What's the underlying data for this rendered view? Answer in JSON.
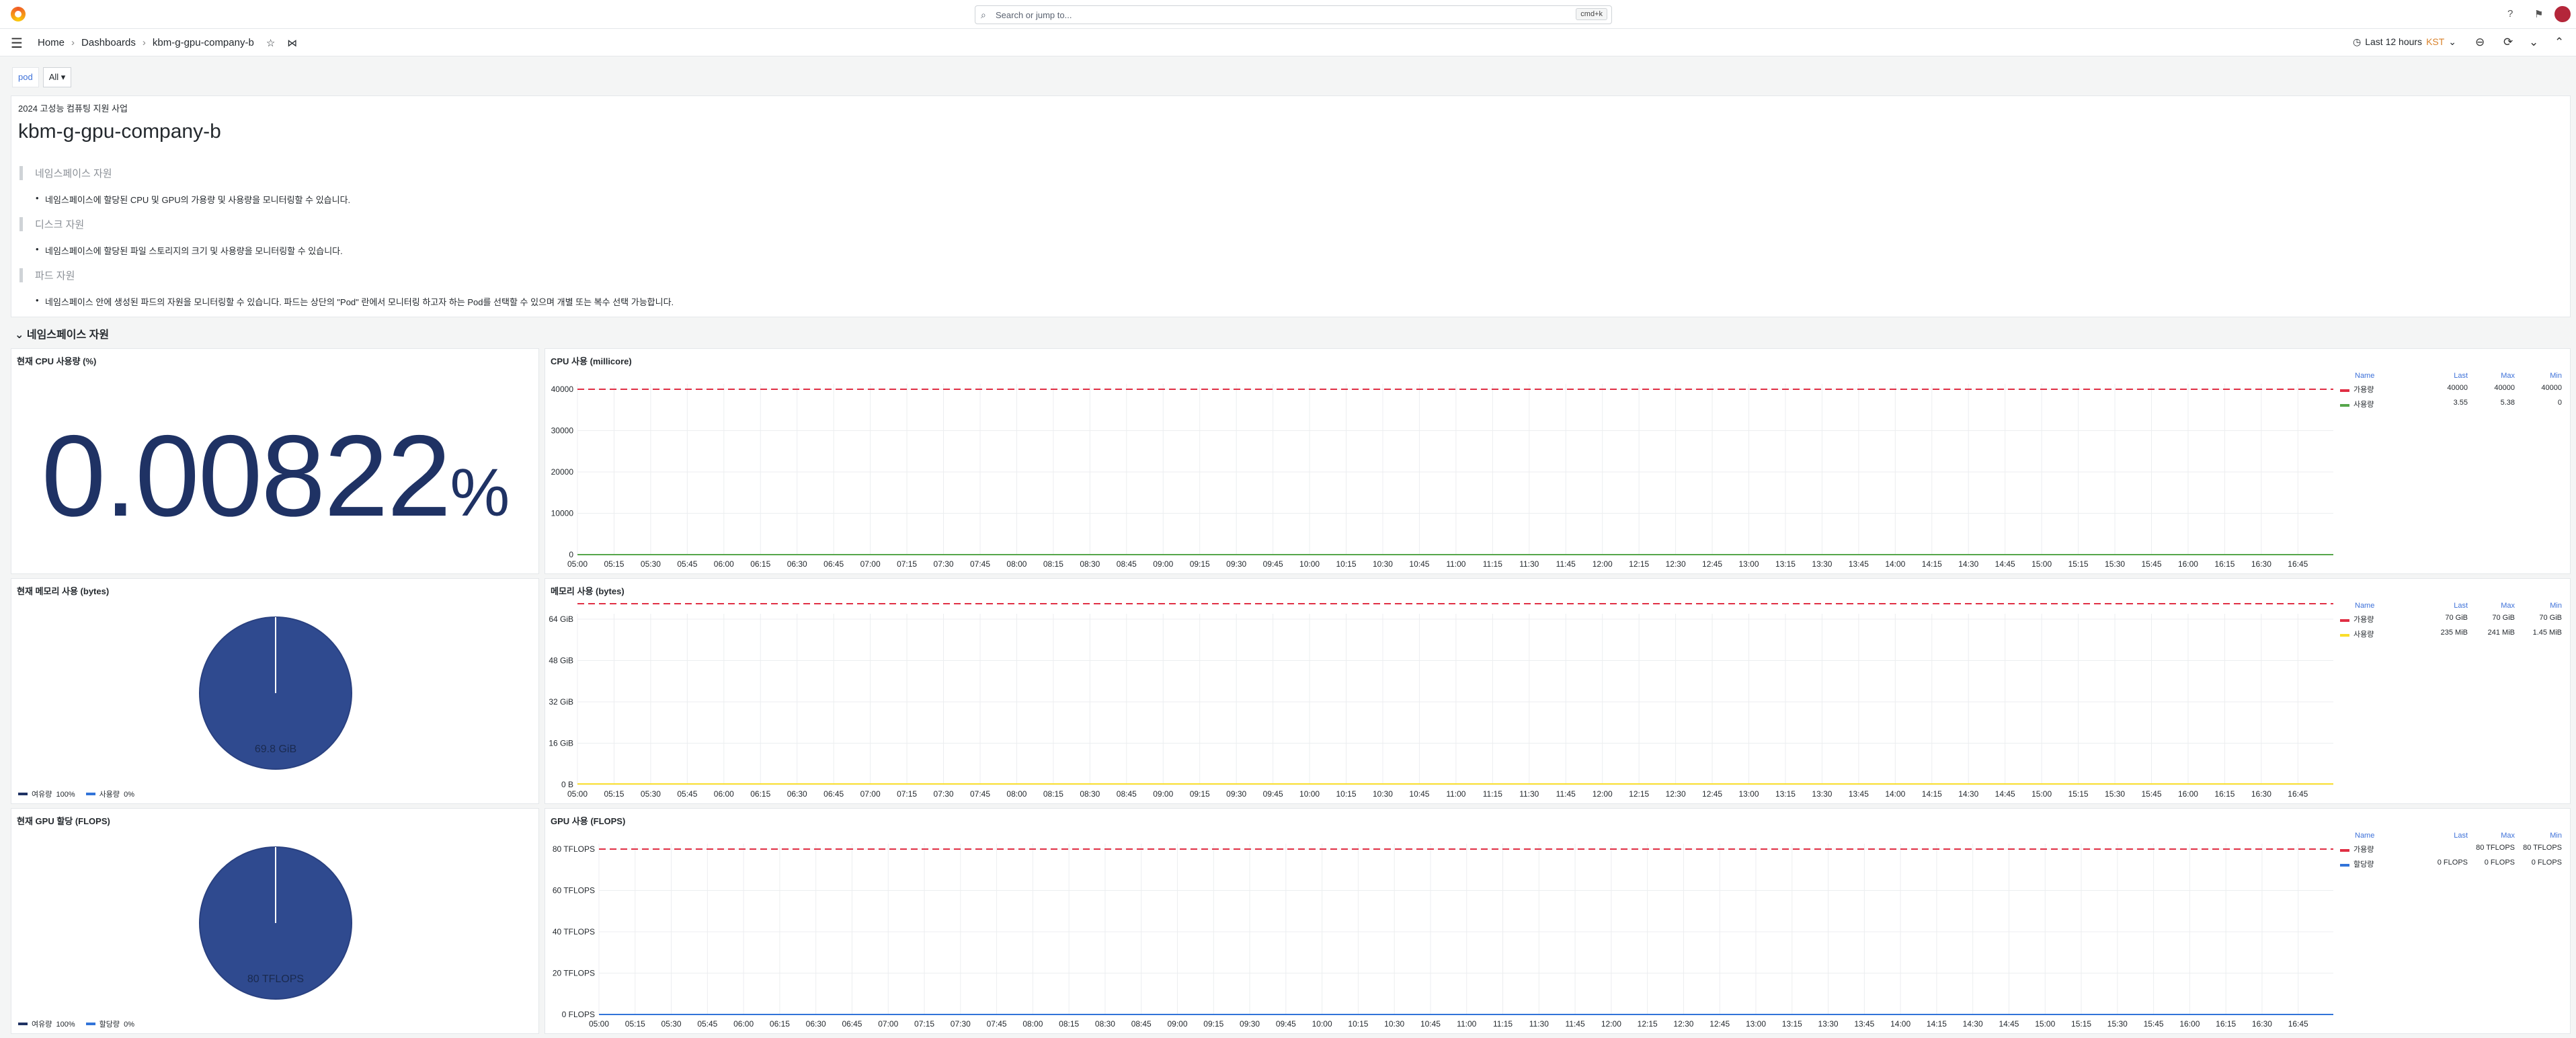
{
  "topbar": {
    "search_placeholder": "Search or jump to...",
    "search_shortcut": "cmd+k"
  },
  "breadcrumb": [
    "Home",
    "Dashboards",
    "kbm-g-gpu-company-b"
  ],
  "time": {
    "range": "Last 12 hours",
    "tz": "KST"
  },
  "vars": {
    "label": "pod",
    "value": "All"
  },
  "text_panel": {
    "subtitle": "2024 고성능 컴퓨팅 지원 사업",
    "title": "kbm-g-gpu-company-b",
    "sections": [
      {
        "heading": "네임스페이스 자원",
        "bullet": "네임스페이스에 할당된 CPU 및 GPU의 가용량 및 사용량을 모니터링할 수 있습니다."
      },
      {
        "heading": "디스크 자원",
        "bullet": "네임스페이스에 할당된 파일 스토리지의 크기 및 사용량을 모니터링할 수 있습니다."
      },
      {
        "heading": "파드 자원",
        "bullet": "네임스페이스 안에 생성된 파드의 자원을 모니터링할 수 있습니다. 파드는 상단의 \"Pod\" 란에서 모니터링 하고자 하는 Pod를 선택할 수 있으며 개별 또는 복수 선택 가능합니다."
      }
    ]
  },
  "row_title": "네임스페이스 자원",
  "colors": {
    "red": "#e02f44",
    "green": "#56a64b",
    "yellow": "#fade2a",
    "blue": "#3274d9",
    "dark": "#1f3264"
  },
  "x_ticks": [
    "05:00",
    "05:15",
    "05:30",
    "05:45",
    "06:00",
    "06:15",
    "06:30",
    "06:45",
    "07:00",
    "07:15",
    "07:30",
    "07:45",
    "08:00",
    "08:15",
    "08:30",
    "08:45",
    "09:00",
    "09:15",
    "09:30",
    "09:45",
    "10:00",
    "10:15",
    "10:30",
    "10:45",
    "11:00",
    "11:15",
    "11:30",
    "11:45",
    "12:00",
    "12:15",
    "12:30",
    "12:45",
    "13:00",
    "13:15",
    "13:30",
    "13:45",
    "14:00",
    "14:15",
    "14:30",
    "14:45",
    "15:00",
    "15:15",
    "15:30",
    "15:45",
    "16:00",
    "16:15",
    "16:30",
    "16:45"
  ],
  "panels": {
    "cpu_stat": {
      "title": "현재 CPU 사용량 (%)",
      "value": "0.00822",
      "unit": "%"
    },
    "cpu_ts": {
      "title": "CPU 사용 (millicore)",
      "y_ticks": [
        "40000",
        "30000",
        "20000",
        "10000",
        "0"
      ],
      "legend_headers": [
        "Name",
        "Last",
        "Max",
        "Min"
      ],
      "legend": [
        {
          "name": "가용량",
          "color": "#e02f44",
          "last": "40000",
          "max": "40000",
          "min": "40000"
        },
        {
          "name": "사용량",
          "color": "#56a64b",
          "last": "3.55",
          "max": "5.38",
          "min": "0"
        }
      ]
    },
    "mem_pie": {
      "title": "현재 메모리 사용 (bytes)",
      "center_label": "69.8 GiB",
      "legend": [
        {
          "name": "여유량",
          "color": "#1f3264",
          "pct": "100%"
        },
        {
          "name": "사용량",
          "color": "#3274d9",
          "pct": "0%"
        }
      ]
    },
    "mem_ts": {
      "title": "메모리 사용 (bytes)",
      "y_ticks": [
        "64 GiB",
        "48 GiB",
        "32 GiB",
        "16 GiB",
        "0 B"
      ],
      "legend_headers": [
        "Name",
        "Last",
        "Max",
        "Min"
      ],
      "legend": [
        {
          "name": "가용량",
          "color": "#e02f44",
          "last": "70 GiB",
          "max": "70 GiB",
          "min": "70 GiB"
        },
        {
          "name": "사용량",
          "color": "#fade2a",
          "last": "235 MiB",
          "max": "241 MiB",
          "min": "1.45 MiB"
        }
      ]
    },
    "gpu_pie": {
      "title": "현재 GPU 할당 (FLOPS)",
      "center_label": "80 TFLOPS",
      "legend": [
        {
          "name": "여유량",
          "color": "#1f3264",
          "pct": "100%"
        },
        {
          "name": "할당량",
          "color": "#3274d9",
          "pct": "0%"
        }
      ]
    },
    "gpu_ts": {
      "title": "GPU 사용 (FLOPS)",
      "y_ticks": [
        "80 TFLOPS",
        "60 TFLOPS",
        "40 TFLOPS",
        "20 TFLOPS",
        "0 FLOPS"
      ],
      "legend_headers": [
        "Name",
        "Last",
        "Max",
        "Min"
      ],
      "legend": [
        {
          "name": "가용량",
          "color": "#e02f44",
          "last": "",
          "max": "80 TFLOPS",
          "min": "80 TFLOPS"
        },
        {
          "name": "할당량",
          "color": "#3274d9",
          "last": "0 FLOPS",
          "max": "0 FLOPS",
          "min": "0 FLOPS"
        }
      ]
    }
  },
  "chart_data": [
    {
      "type": "line",
      "title": "CPU 사용 (millicore)",
      "ylim": [
        0,
        40000
      ],
      "series": [
        {
          "name": "가용량",
          "values": [
            40000,
            40000
          ]
        },
        {
          "name": "사용량",
          "values": [
            3.55,
            3.55
          ]
        }
      ]
    },
    {
      "type": "line",
      "title": "메모리 사용 (bytes)",
      "ylim": [
        0,
        64
      ],
      "series": [
        {
          "name": "가용량",
          "values": [
            70,
            70
          ]
        },
        {
          "name": "사용량",
          "values": [
            0.23,
            0.23
          ]
        }
      ]
    },
    {
      "type": "pie",
      "title": "현재 메모리 사용 (bytes)",
      "categories": [
        "여유량",
        "사용량"
      ],
      "values": [
        100,
        0
      ]
    },
    {
      "type": "pie",
      "title": "현재 GPU 할당 (FLOPS)",
      "categories": [
        "여유량",
        "할당량"
      ],
      "values": [
        100,
        0
      ]
    },
    {
      "type": "line",
      "title": "GPU 사용 (FLOPS)",
      "ylim": [
        0,
        80
      ],
      "series": [
        {
          "name": "가용량",
          "values": [
            80,
            80
          ]
        },
        {
          "name": "할당량",
          "values": [
            0,
            0
          ]
        }
      ]
    }
  ]
}
